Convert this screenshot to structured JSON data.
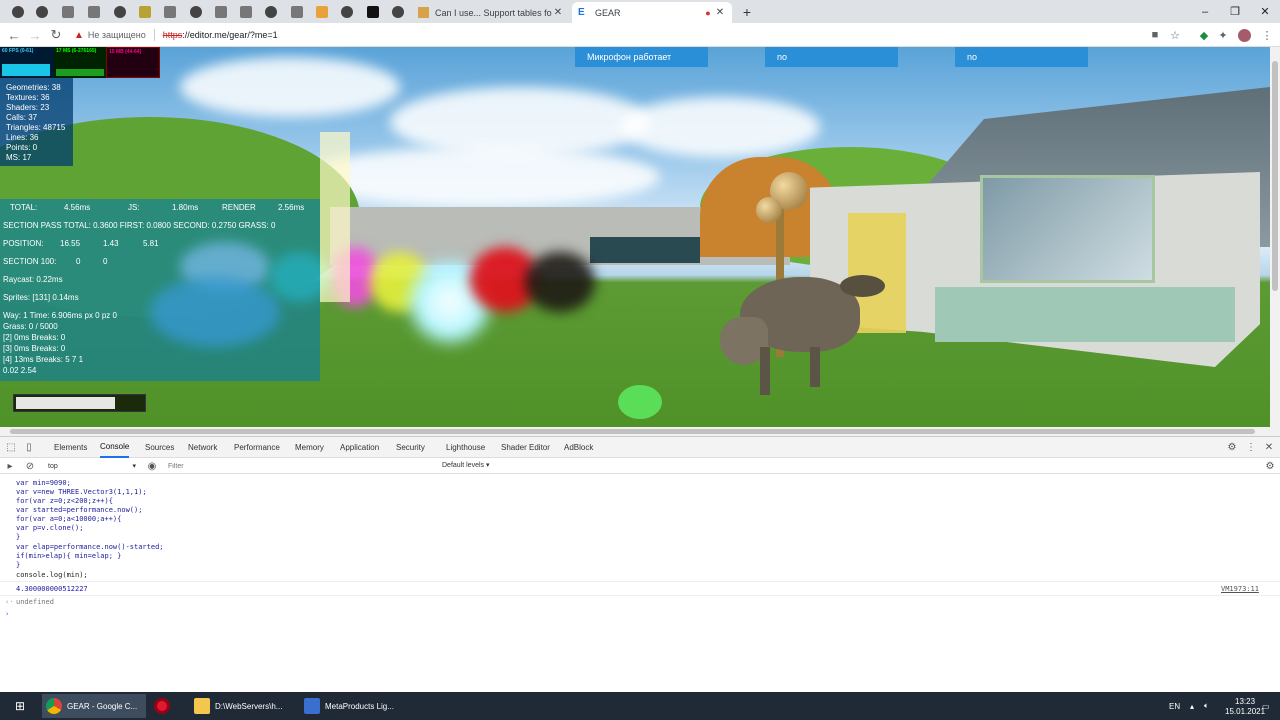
{
  "browser": {
    "tabs": [
      {
        "title": "Can I use... Support tables for HT",
        "active": false
      },
      {
        "title": "GEAR",
        "active": true
      }
    ],
    "new_tab": "+",
    "address": {
      "security_label": "Не защищено",
      "url_scheme": "https",
      "url_rest": "://editor.me/gear/?me=1"
    }
  },
  "hud": {
    "fps": [
      "60 FPS (0-61)",
      "17 MS (6-276165)",
      "15 MB (44-64)"
    ],
    "renderer_info": [
      "Geometries: 38",
      "Textures: 36",
      "Shaders: 23",
      "Calls: 37",
      "Triangles: 48715",
      "Lines: 36",
      "Points: 0",
      "MS: 17"
    ],
    "timing": {
      "total_label": "TOTAL:",
      "total_value": "4.56ms",
      "js_label": "JS:",
      "js_value": "1.80ms",
      "render_label": "RENDER",
      "render_value": "2.56ms"
    },
    "section_pass": "SECTION PASS TOTAL: 0.3600 FIRST: 0.0800 SECOND: 0.2750 GRASS: 0",
    "position": {
      "label": "POSITION:",
      "x": "16.55",
      "y": "1.43",
      "z": "5.81"
    },
    "section100": {
      "label": "SECTION 100:",
      "a": "0",
      "b": "0"
    },
    "raycast": "Raycast: 0.22ms",
    "sprites": "Sprites: [131] 0.14ms",
    "way_lines": [
      "Way: 1 Time: 6.906ms px 0 pz 0",
      "Grass: 0 / 5000",
      "[2] 0ms Breaks: 0",
      "[3] 0ms Breaks: 0",
      "[4] 13ms Breaks: 5 7 1",
      "0.02 2.54"
    ],
    "progress": 0.78,
    "buttons": [
      "Микрофон работает",
      "no",
      "no"
    ]
  },
  "devtools": {
    "tabs": [
      "Elements",
      "Console",
      "Sources",
      "Network",
      "Performance",
      "Memory",
      "Application",
      "Security",
      "Lighthouse",
      "Shader Editor",
      "AdBlock"
    ],
    "active_tab": "Console",
    "context": "top",
    "filter_placeholder": "Filter",
    "levels": "Default levels ▾",
    "code": [
      "var min=9090;",
      "var v=new THREE.Vector3(1,1,1);",
      "for(var z=0;z<200;z++){",
      "var started=performance.now();",
      "for(var a=0;a<10000;a++){",
      "var p=v.clone();",
      "}",
      "var elap=performance.now()-started;",
      "if(min>elap){ min=elap; }",
      "}",
      "console.log(min);"
    ],
    "log_value": "4.300000000512227",
    "log_source": "VM1973:11",
    "return_value": "undefined"
  },
  "taskbar": {
    "apps": [
      "GEAR - Google C...",
      "",
      "D:\\WebServers\\h...",
      "MetaProducts Lig..."
    ],
    "lang": "EN",
    "time": "13:23",
    "date": "15.01.2021"
  }
}
